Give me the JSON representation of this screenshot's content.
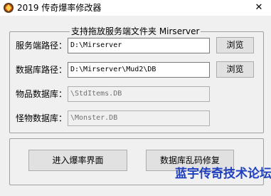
{
  "window": {
    "title": "2019 传奇爆率修改器",
    "close_glyph": "✕"
  },
  "group": {
    "title": "支持拖放服务端文件夹 Mirserver"
  },
  "fields": [
    {
      "label": "服务端路径：",
      "value": "D:\\Mirserver",
      "browse_label": "浏览"
    },
    {
      "label": "数据库路径：",
      "value": "D:\\Mirserver\\Mud2\\DB",
      "browse_label": "浏览"
    },
    {
      "label": "物品数据库：",
      "value": "\\StdItems.DB"
    },
    {
      "label": "怪物数据库：",
      "value": "\\Monster.DB"
    }
  ],
  "actions": {
    "enter_label": "进入爆率界面",
    "repair_label": "数据库乱码修复"
  },
  "watermark": "蓝宇传奇技术论坛",
  "colors": {
    "watermark": "#1f3fbf",
    "window_bg": "#f0f0f0",
    "icon_accent": "#e05a10"
  }
}
